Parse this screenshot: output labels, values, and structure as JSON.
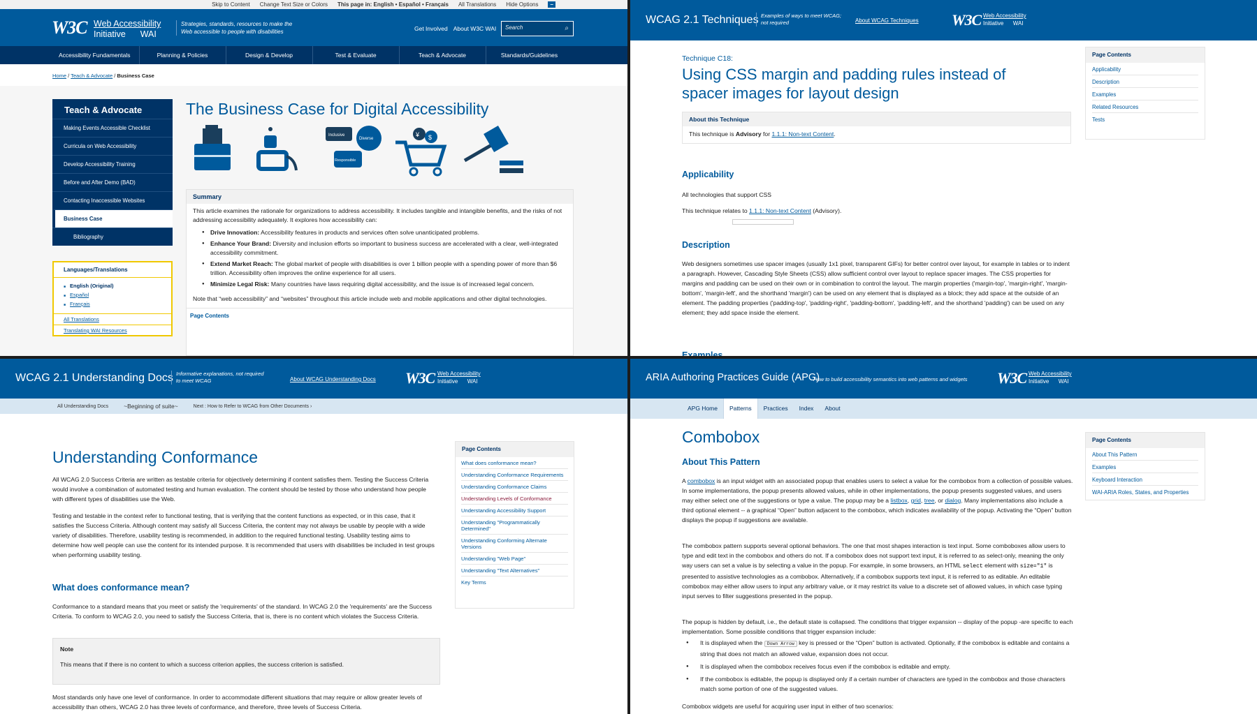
{
  "q1": {
    "util": [
      "Skip to Content",
      "Change Text Size or Colors",
      "This page in: English • Español • Français",
      "All Translations",
      "Hide Options"
    ],
    "logo": "W3C",
    "wai": [
      "Web Accessibility",
      "Initiative",
      "WAI"
    ],
    "tagline": "Strategies, standards, resources to make the Web accessible to people with disabilities",
    "header_links": [
      "Get Involved",
      "About W3C WAI"
    ],
    "search_placeholder": "Search",
    "nav": [
      "Accessibility Fundamentals",
      "Planning & Policies",
      "Design & Develop",
      "Test & Evaluate",
      "Teach & Advocate",
      "Standards/Guidelines"
    ],
    "breadcrumbs": [
      "Home",
      "Teach & Advocate",
      "Business Case"
    ],
    "side_title": "Teach & Advocate",
    "side_items": [
      "Making Events Accessible Checklist",
      "Curricula on Web Accessibility",
      "Develop Accessibility Training",
      "Before and After Demo (BAD)",
      "Contacting Inaccessible Websites",
      "Business Case",
      "Bibliography"
    ],
    "lang_title": "Languages/Translations",
    "langs": [
      "English (Original)",
      "Español",
      "Français"
    ],
    "lang_links": [
      "All Translations",
      "Translating WAI Resources"
    ],
    "title": "The Business Case for Digital Accessibility",
    "bubbles": [
      "Inclusive",
      "Diverse",
      "Responsible"
    ],
    "summary_title": "Summary",
    "summary_intro": "This article examines the rationale for organizations to address accessibility. It includes tangible and intangible benefits, and the risks of not addressing accessibility adequately. It explores how accessibility can:",
    "bullets": [
      {
        "b": "Drive Innovation:",
        "t": " Accessibility features in products and services often solve unanticipated problems."
      },
      {
        "b": "Enhance Your Brand:",
        "t": " Diversity and inclusion efforts so important to business success are accelerated with a clear, well-integrated accessibility commitment."
      },
      {
        "b": "Extend Market Reach:",
        "t": " The global market of people with disabilities is over 1 billion people with a spending power of more than $6 trillion. Accessibility often improves the online experience for all users."
      },
      {
        "b": "Minimize Legal Risk:",
        "t": " Many countries have laws requiring digital accessibility, and the issue is of increased legal concern."
      }
    ],
    "summary_note": "Note that “web accessibility” and “websites” throughout this article include web and mobile applications and other digital technologies.",
    "page_contents": "Page Contents"
  },
  "q2": {
    "header_title": "WCAG 2.1 Techniques",
    "header_tag": "Examples of ways to meet WCAG; not required",
    "header_about": "About WCAG Techniques",
    "kicker": "Technique C18:",
    "title": "Using CSS margin and padding rules instead of spacer images for layout design",
    "about_title": "About this Technique",
    "about_pre": "This technique is ",
    "about_bold": "Advisory",
    "about_mid": " for ",
    "about_link": "1.1.1: Non-text Content",
    "about_end": ".",
    "applicability_h": "Applicability",
    "applicability_1": "All technologies that support CSS",
    "applicability_2_pre": "This technique relates to ",
    "applicability_2_link": "1.1.1: Non-text Content",
    "applicability_2_end": " (Advisory).",
    "description_h": "Description",
    "description": "Web designers sometimes use spacer images (usually 1x1 pixel, transparent GIFs) for better control over layout, for example in tables or to indent a paragraph. However, Cascading Style Sheets (CSS) allow sufficient control over layout to replace spacer images. The CSS properties for margins and padding can be used on their own or in combination to control the layout. The margin properties ('margin-top', 'margin-right', 'margin-bottom', 'margin-left', and the shorthand 'margin') can be used on any element that is displayed as a block; they add space at the outside of an element. The padding properties ('padding-top', 'padding-right', 'padding-bottom', 'padding-left', and the shorthand 'padding') can be used on any element; they add space inside the element.",
    "examples_h": "Examples",
    "toc_title": "Page Contents",
    "toc": [
      "Applicability",
      "Description",
      "Examples",
      "Related Resources",
      "Tests"
    ]
  },
  "q3": {
    "header_title": "WCAG 2.1 Understanding Docs",
    "header_tag": "Informative explanations, not required to meet WCAG",
    "header_about": "About WCAG Understanding Docs",
    "sub": [
      "All Understanding Docs",
      "~Beginning of suite~",
      "Next : How to Refer to WCAG from Other Documents"
    ],
    "title": "Understanding Conformance",
    "p1": "All WCAG 2.0 Success Criteria are written as testable criteria for objectively determining if content satisfies them. Testing the Success Criteria would involve a combination of automated testing and human evaluation. The content should be tested by those who understand how people with different types of disabilities use the Web.",
    "p2": "Testing and testable in the context refer to functional testing, that is verifying that the content functions as expected, or in this case, that it satisfies the Success Criteria. Although content may satisfy all Success Criteria, the content may not always be usable by people with a wide variety of disabilities. Therefore, usability testing is recommended, in addition to the required functional testing. Usability testing aims to determine how well people can use the content for its intended purpose. It is recommended that users with disabilities be included in test groups when performing usability testing.",
    "h2": "What does conformance mean?",
    "p3": "Conformance to a standard means that you meet or satisfy the 'requirements' of the standard. In WCAG 2.0 the 'requirements' are the Success Criteria. To conform to WCAG 2.0, you need to satisfy the Success Criteria, that is, there is no content which violates the Success Criteria.",
    "note_title": "Note",
    "note": "This means that if there is no content to which a success criterion applies, the success criterion is satisfied.",
    "p4": "Most standards only have one level of conformance. In order to accommodate different situations that may require or allow greater levels of accessibility than others, WCAG 2.0 has three levels of conformance, and therefore, three levels of Success Criteria.",
    "toc_title": "Page Contents",
    "toc": [
      "What does conformance mean?",
      "Understanding Conformance Requirements",
      "Understanding Conformance Claims",
      "Understanding Levels of Conformance",
      "Understanding Accessibility Support",
      "Understanding \"Programmatically Determined\"",
      "Understanding Conforming Alternate Versions",
      "Understanding \"Web Page\"",
      "Understanding \"Text Alternatives\"",
      "Key Terms"
    ]
  },
  "q4": {
    "header_title": "ARIA Authoring Practices Guide (APG)",
    "header_tag": "How to build accessibility semantics into web patterns and widgets",
    "tabs": [
      "APG Home",
      "Patterns",
      "Practices",
      "Index",
      "About"
    ],
    "title": "Combobox",
    "h2": "About This Pattern",
    "p1_link": "combobox",
    "p1": " is an input widget with an associated popup that enables users to select a value for the combobox from a collection of possible values. In some implementations, the popup presents allowed values, while in other implementations, the popup presents suggested values, and users may either select one of the suggestions or type a value. The popup may be a ",
    "p1_a": "A ",
    "p1_links": [
      "listbox",
      "grid",
      "tree",
      "dialog"
    ],
    "p1_end": ". Many implementations also include a third optional element -- a graphical “Open” button adjacent to the combobox, which indicates availability of the popup. Activating the “Open” button displays the popup if suggestions are available.",
    "p2_a": "The combobox pattern supports several optional behaviors. The one that most shapes interaction is text input. Some comboboxes allow users to type and edit text in the combobox and others do not. If a combobox does not support text input, it is referred to as select-only, meaning the only way users can set a value is by selecting a value in the popup. For example, in some browsers, an HTML ",
    "p2_code1": "select",
    "p2_b": " element with ",
    "p2_code2": "size=\"1\"",
    "p2_c": " is presented to assistive technologies as a combobox. Alternatively, if a combobox supports text input, it is referred to as editable. An editable combobox may either allow users to input any arbitrary value, or it may restrict its value to a discrete set of allowed values, in which case typing input serves to filter suggestions presented in the popup.",
    "p3": "The popup is hidden by default, i.e., the default state is collapsed. The conditions that trigger expansion -- display of the popup -are specific to each implementation. Some possible conditions that trigger expansion include:",
    "li1_a": "It is displayed when the ",
    "li1_kbd": "Down Arrow",
    "li1_b": " key is pressed or the “Open” button is activated. Optionally, if the combobox is editable and contains a string that does not match an allowed value, expansion does not occur.",
    "li2": "It is displayed when the combobox receives focus even if the combobox is editable and empty.",
    "li3": "If the combobox is editable, the popup is displayed only if a certain number of characters are typed in the combobox and those characters match some portion of one of the suggested values.",
    "p4": "Combobox widgets are useful for acquiring user input in either of two scenarios:",
    "toc_title": "Page Contents",
    "toc": [
      "About This Pattern",
      "Examples",
      "Keyboard Interaction",
      "WAI-ARIA Roles, States, and Properties"
    ]
  },
  "common": {
    "logo": "W3C",
    "wai1": "Web Accessibility",
    "wai2": "Initiative",
    "wai3": "WAI"
  }
}
